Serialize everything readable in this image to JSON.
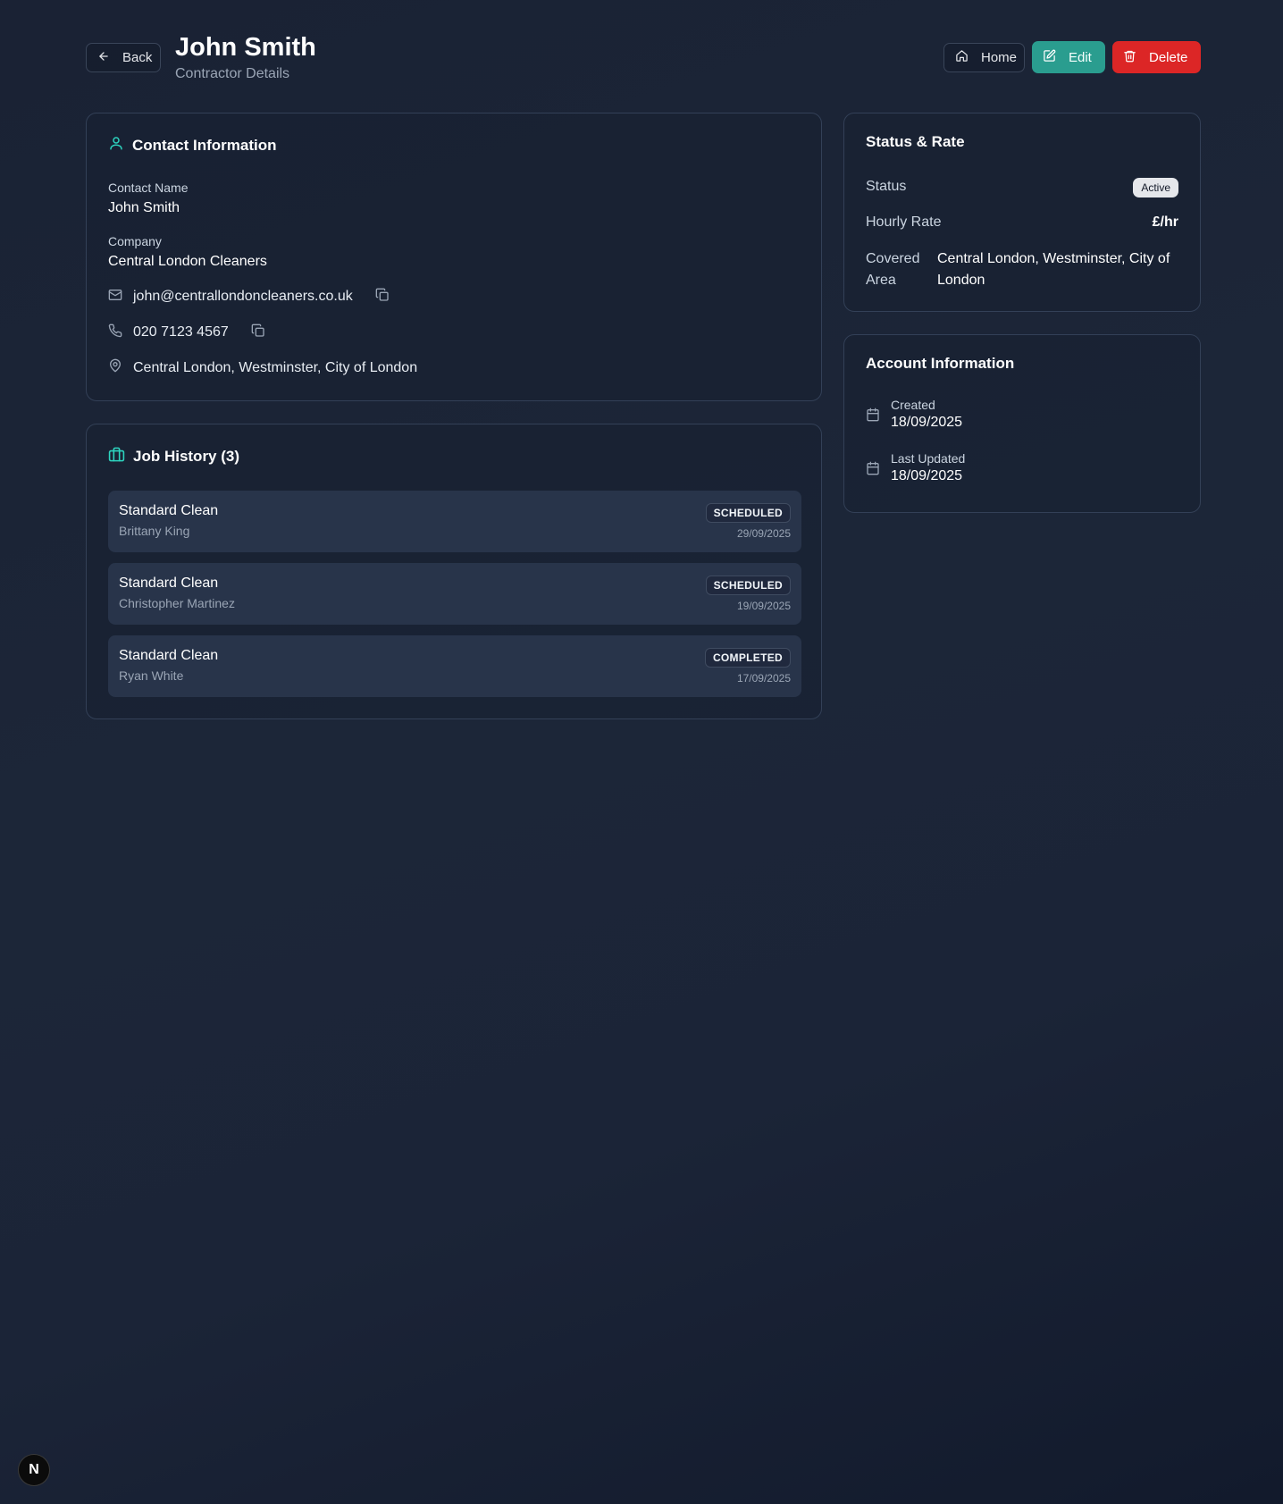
{
  "header": {
    "back_label": "Back",
    "title": "John Smith",
    "subtitle": "Contractor Details",
    "home_label": "Home",
    "edit_label": "Edit",
    "delete_label": "Delete"
  },
  "contact": {
    "title": "Contact Information",
    "contact_name_label": "Contact Name",
    "contact_name": "John Smith",
    "company_label": "Company",
    "company": "Central London Cleaners",
    "email": "john@centrallondoncleaners.co.uk",
    "phone": "020 7123 4567",
    "location": "Central London, Westminster, City of London"
  },
  "jobs": {
    "title": "Job History (3)",
    "items": [
      {
        "title": "Standard Clean",
        "client": "Brittany King",
        "status": "SCHEDULED",
        "date": "29/09/2025"
      },
      {
        "title": "Standard Clean",
        "client": "Christopher Martinez",
        "status": "SCHEDULED",
        "date": "19/09/2025"
      },
      {
        "title": "Standard Clean",
        "client": "Ryan White",
        "status": "COMPLETED",
        "date": "17/09/2025"
      }
    ]
  },
  "status_rate": {
    "title": "Status & Rate",
    "status_label": "Status",
    "status_value": "Active",
    "hourly_rate_label": "Hourly Rate",
    "hourly_rate_value": "£/hr",
    "covered_area_label": "Covered Area",
    "covered_area_value": "Central London, Westminster, City of London"
  },
  "account": {
    "title": "Account Information",
    "created_label": "Created",
    "created_value": "18/09/2025",
    "updated_label": "Last Updated",
    "updated_value": "18/09/2025"
  },
  "dev_badge": "N",
  "colors": {
    "accent_teal": "#2a9d8f",
    "danger_red": "#dc2626",
    "icon_teal": "#2dd4bf"
  }
}
